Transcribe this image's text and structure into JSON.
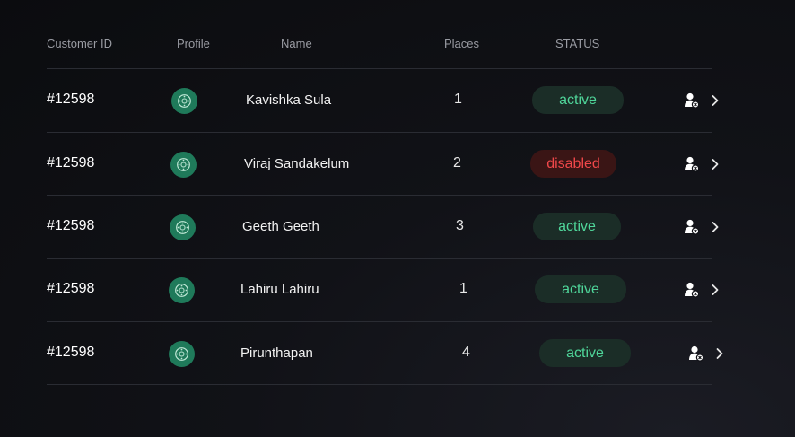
{
  "table": {
    "columns": [
      "Customer ID",
      "Profile",
      "Name",
      "Places",
      "STATUS"
    ],
    "rows": [
      {
        "id": "#12598",
        "name": "Kavishka Sula",
        "places": "1",
        "status": "active"
      },
      {
        "id": "#12598",
        "name": "Viraj Sandakelum",
        "places": "2",
        "status": "disabled"
      },
      {
        "id": "#12598",
        "name": "Geeth Geeth",
        "places": "3",
        "status": "active"
      },
      {
        "id": "#12598",
        "name": "Lahiru Lahiru",
        "places": "1",
        "status": "active"
      },
      {
        "id": "#12598",
        "name": "Pirunthapan",
        "places": "4",
        "status": "active"
      }
    ]
  },
  "icons": {
    "profile": "avatar-icon",
    "action": "remove-user-icon",
    "open": "chevron-right-icon"
  },
  "colors": {
    "avatar_bg": "#1f7a5a",
    "active_text": "#4fd69a",
    "active_bg": "#1b2d27",
    "disabled_text": "#f0484a",
    "disabled_bg": "#3a1515"
  }
}
